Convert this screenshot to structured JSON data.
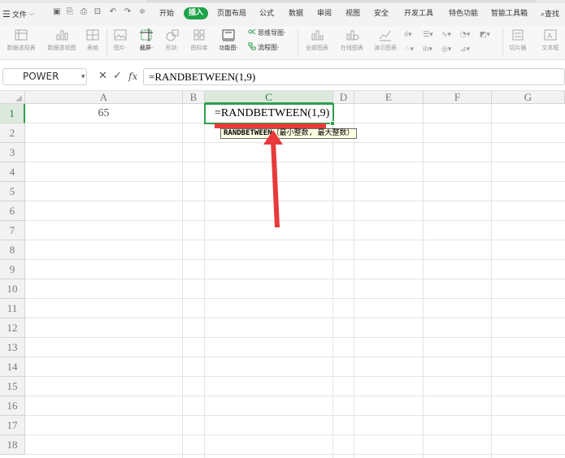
{
  "menubar": {
    "file_label": "文件",
    "tabs": [
      "开始",
      "插入",
      "页面布局",
      "公式",
      "数据",
      "审阅",
      "视图",
      "安全",
      "开发工具",
      "特色功能",
      "智能工具箱"
    ],
    "active_tab": "插入",
    "search_label": "查找"
  },
  "ribbon": {
    "items": {
      "pivot_table": "数据透视表",
      "pivot_chart": "数据透视图",
      "table": "表格",
      "image": "图片·",
      "screenshot": "截屏·",
      "shape": "形状·",
      "icon_lib": "图标库",
      "function_chart": "功能图·",
      "mind_map": "思维导图·",
      "flowchart": "流程图·",
      "all_charts": "全部图表",
      "online_charts": "在线图表",
      "demo_charts": "演示图表",
      "slicer": "切片器",
      "textbox": "文本框"
    }
  },
  "formula_bar": {
    "name_box": "POWER",
    "cancel_symbol": "✕",
    "confirm_symbol": "✓",
    "fx_label": "fx",
    "formula": "=RANDBETWEEN(1,9)"
  },
  "grid": {
    "columns": [
      "A",
      "B",
      "C",
      "D",
      "E",
      "F",
      "G"
    ],
    "rows": [
      "1",
      "2",
      "3",
      "4",
      "5",
      "6",
      "7",
      "8",
      "9",
      "10",
      "11",
      "12",
      "13",
      "14",
      "15",
      "16",
      "17",
      "18"
    ],
    "active_column": "C",
    "active_row": "1",
    "cells": {
      "A1": "65",
      "C1": "=RANDBETWEEN(1,9)"
    },
    "tooltip": {
      "function": "RANDBETWEEN",
      "args": "（最小整数, 最大整数）"
    }
  },
  "colors": {
    "accent_green": "#1fa34a",
    "selection_green": "#2e9e4d",
    "annotation_red": "#e83a3a"
  }
}
